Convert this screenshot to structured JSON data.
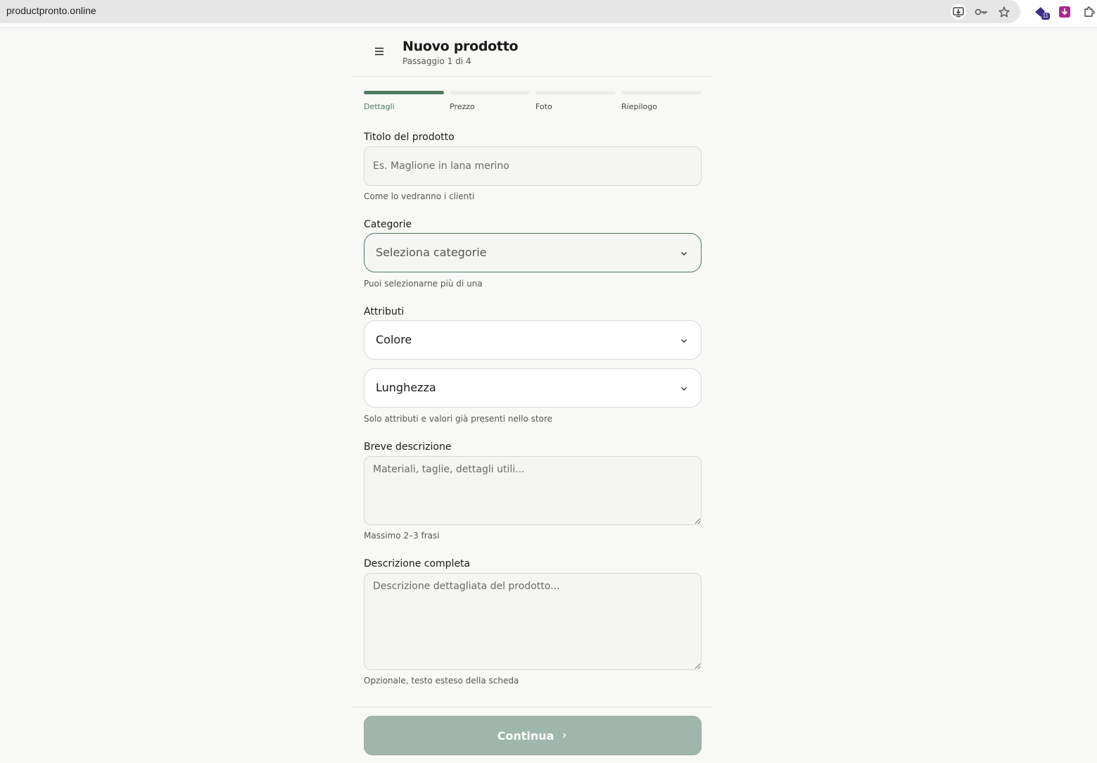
{
  "browser": {
    "url": "productpronto.online",
    "extension_badge": "11"
  },
  "header": {
    "title": "Nuovo prodotto",
    "subtitle": "Passaggio 1 di 4"
  },
  "steps": [
    {
      "label": "Dettagli",
      "active": true
    },
    {
      "label": "Prezzo",
      "active": false
    },
    {
      "label": "Foto",
      "active": false
    },
    {
      "label": "Riepilogo",
      "active": false
    }
  ],
  "form": {
    "title": {
      "label": "Titolo del prodotto",
      "placeholder": "Es. Maglione in lana merino",
      "value": "",
      "hint": "Come lo vedranno i clienti"
    },
    "categories": {
      "label": "Categorie",
      "placeholder": "Seleziona categorie",
      "hint": "Puoi selezionarne più di una"
    },
    "attributes": {
      "label": "Attributi",
      "items": [
        "Colore",
        "Lunghezza"
      ],
      "hint": "Solo attributi e valori già presenti nello store"
    },
    "short_description": {
      "label": "Breve descrizione",
      "placeholder": "Materiali, taglie, dettagli utili...",
      "hint": "Massimo 2–3 frasi"
    },
    "full_description": {
      "label": "Descrizione completa",
      "placeholder": "Descrizione dettagliata del prodotto...",
      "hint": "Opzionale, testo esteso della scheda"
    }
  },
  "footer": {
    "continue_label": "Continua"
  },
  "colors": {
    "accent": "#4e7a5f",
    "button_disabled": "#9fb7aa",
    "background": "#f8f8f6"
  },
  "icons": {
    "menu": "menu-icon",
    "chevron": "chevron-down-icon",
    "arrow": "chevron-right-icon"
  }
}
